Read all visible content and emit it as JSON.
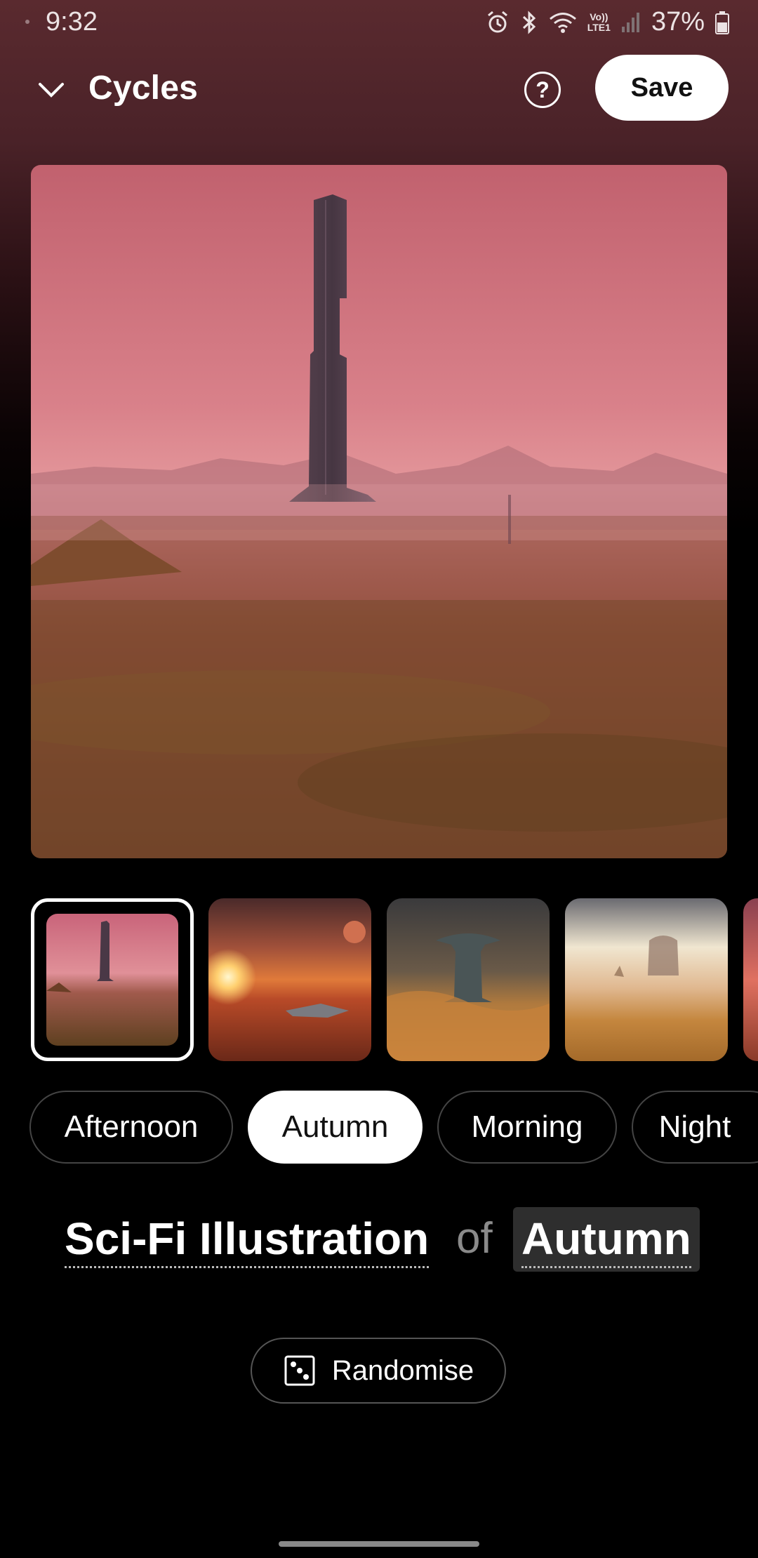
{
  "status_bar": {
    "time": "9:32",
    "battery_percent": "37%",
    "lte_label_top": "Vo))",
    "lte_label_bottom": "LTE1",
    "icons": [
      "alarm-icon",
      "bluetooth-icon",
      "wifi-icon",
      "lte-icon",
      "signal-icon",
      "battery-icon"
    ]
  },
  "header": {
    "title": "Cycles",
    "help_symbol": "?",
    "save_label": "Save",
    "collapse_icon": "chevron-down-icon"
  },
  "preview": {
    "description_icon": "generated-image"
  },
  "thumbnails": [
    {
      "name": "thumbnail-tower",
      "selected": true
    },
    {
      "name": "thumbnail-sunset-ship",
      "selected": false
    },
    {
      "name": "thumbnail-mushroom-tower",
      "selected": false
    },
    {
      "name": "thumbnail-hazy-structure",
      "selected": false
    }
  ],
  "chips": [
    {
      "label": "Afternoon",
      "active": false
    },
    {
      "label": "Autumn",
      "active": true
    },
    {
      "label": "Morning",
      "active": false
    },
    {
      "label": "Night",
      "active": false
    }
  ],
  "prompt": {
    "style": "Sci-Fi Illustration",
    "connector": "of",
    "subject": "Autumn"
  },
  "randomise": {
    "label": "Randomise",
    "icon": "dice-icon"
  },
  "colors": {
    "background": "#000000",
    "header_tint": "#5a2a2f",
    "accent": "#ffffff"
  }
}
